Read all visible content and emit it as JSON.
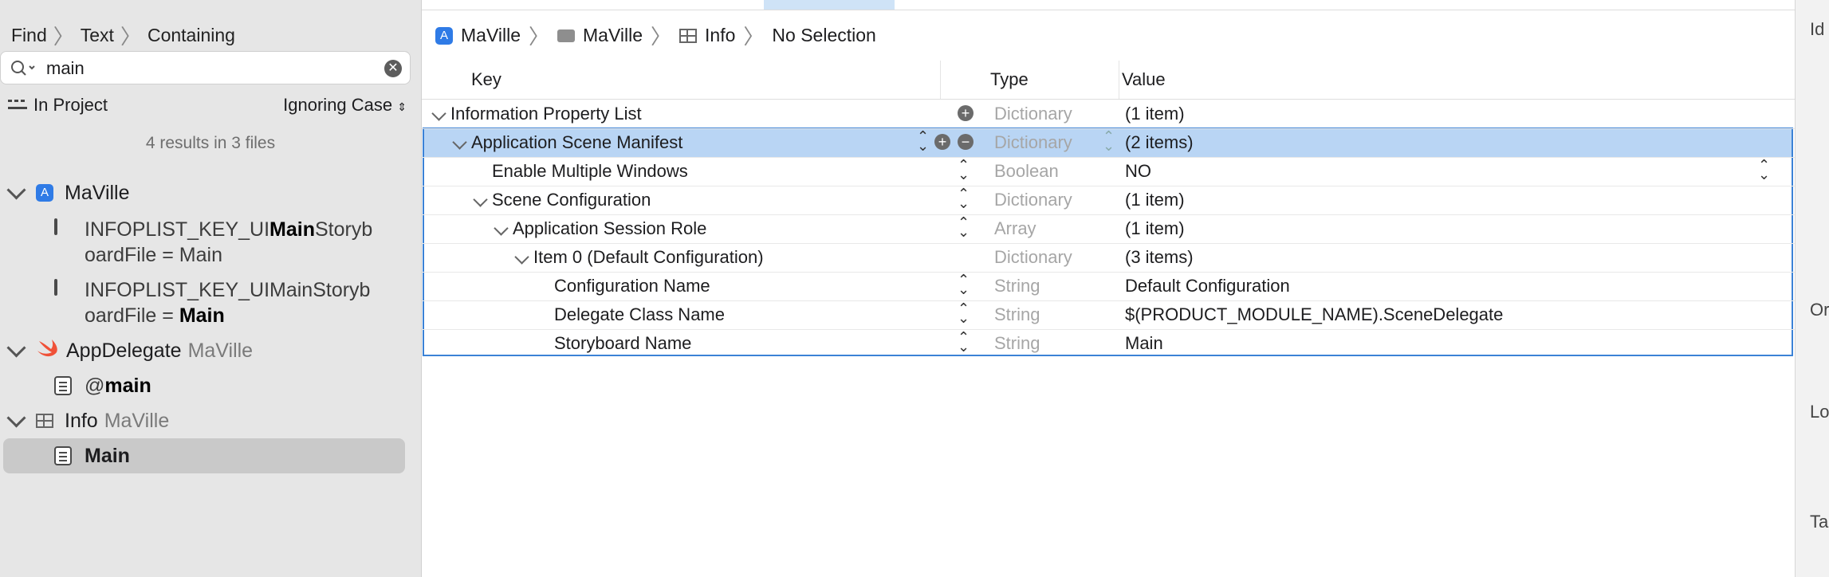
{
  "find_nav": {
    "crumbs": [
      "Find",
      "Text",
      "Containing"
    ],
    "search_value": "main",
    "scope": "In Project",
    "case_option": "Ignoring Case",
    "results_summary": "4 results in 3 files",
    "groups": [
      {
        "name": "MaVille",
        "sub": ""
      },
      {
        "name": "AppDelegate",
        "sub": "MaVille"
      },
      {
        "name": "Info",
        "sub": "MaVille"
      }
    ],
    "r1_a": "INFOPLIST_KEY_UI",
    "r1_b": "Main",
    "r1_c": "Storyb",
    "r1_d": "oardFile = Main",
    "r2_a": "INFOPLIST_KEY_UIMainStoryb",
    "r2_b": "oardFile = ",
    "r2_c": "Main",
    "r3_a": "@",
    "r3_b": "main",
    "r4": "Main"
  },
  "editor": {
    "path": [
      "MaVille",
      "MaVille",
      "Info",
      "No Selection"
    ],
    "columns": {
      "key": "Key",
      "type": "Type",
      "value": "Value"
    },
    "rows": [
      {
        "key": "Information Property List",
        "type": "Dictionary",
        "value": "(1 item)"
      },
      {
        "key": "Application Scene Manifest",
        "type": "Dictionary",
        "value": "(2 items)"
      },
      {
        "key": "Enable Multiple Windows",
        "type": "Boolean",
        "value": "NO"
      },
      {
        "key": "Scene Configuration",
        "type": "Dictionary",
        "value": "(1 item)"
      },
      {
        "key": "Application Session Role",
        "type": "Array",
        "value": "(1 item)"
      },
      {
        "key": "Item 0 (Default Configuration)",
        "type": "Dictionary",
        "value": "(3 items)"
      },
      {
        "key": "Configuration Name",
        "type": "String",
        "value": "Default Configuration"
      },
      {
        "key": "Delegate Class Name",
        "type": "String",
        "value": "$(PRODUCT_MODULE_NAME).SceneDelegate"
      },
      {
        "key": "Storyboard Name",
        "type": "String",
        "value": "Main"
      }
    ]
  },
  "inspector": {
    "labels": [
      "Id",
      "Or",
      "Lo",
      "Ta"
    ]
  },
  "colors": {
    "selection": "#b9d5f4",
    "accent": "#3b82d6",
    "swift": "#f05138"
  }
}
